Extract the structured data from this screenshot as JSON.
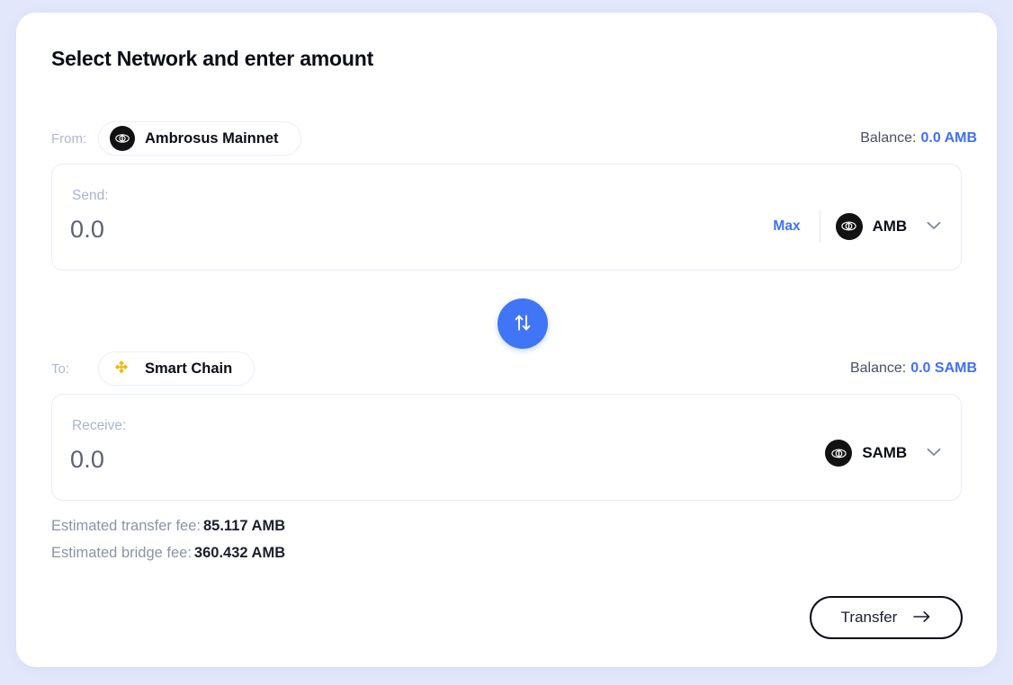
{
  "page": {
    "title": "Select Network and enter amount",
    "background_color": "#e2e7fb",
    "card_color": "#ffffff",
    "accent_color": "#3f70f7"
  },
  "from": {
    "direction_label": "From:",
    "network_name": "Ambrosus Mainnet",
    "network_icon": "ambrosus-icon",
    "balance_label": "Balance:",
    "balance_value": "0.0 AMB"
  },
  "send": {
    "label": "Send:",
    "value": "0.0",
    "placeholder": "0.0",
    "max_label": "Max",
    "token_symbol": "AMB",
    "token_icon": "ambrosus-icon",
    "chevron_icon": "chevron-down-icon"
  },
  "swap": {
    "icon": "swap-vertical-icon",
    "color": "#4075f5"
  },
  "to": {
    "direction_label": "To:",
    "network_name": "Smart Chain",
    "network_icon": "binance-smart-chain-icon",
    "balance_label": "Balance:",
    "balance_value": "0.0 SAMB"
  },
  "receive": {
    "label": "Receive:",
    "value": "0.0",
    "placeholder": "0.0",
    "token_symbol": "SAMB",
    "token_icon": "ambrosus-icon",
    "chevron_icon": "chevron-down-icon"
  },
  "fees": {
    "transfer_label": "Estimated transfer fee:",
    "transfer_value": "85.117 AMB",
    "bridge_label": "Estimated bridge fee:",
    "bridge_value": "360.432 AMB"
  },
  "actions": {
    "transfer_label": "Transfer",
    "transfer_arrow_icon": "arrow-right-icon"
  }
}
